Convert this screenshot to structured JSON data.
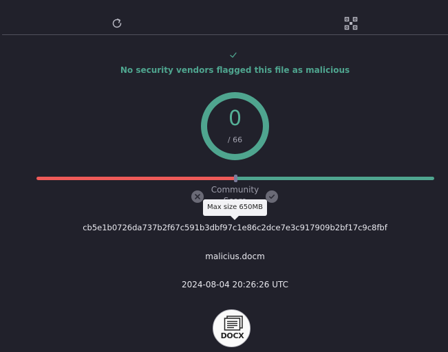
{
  "toolbar": {
    "reload_icon": "reload-icon",
    "qr_icon": "qr-code-icon"
  },
  "verdict": {
    "text": "No security vendors flagged this file as malicious",
    "color": "#4fa58f"
  },
  "detection": {
    "score": "0",
    "total": "/ 66",
    "ratio": 0
  },
  "community": {
    "label": "Community Score",
    "tooltip": "Max size 650MB",
    "score_fraction": 0.5,
    "negative_color": "#ef5a58",
    "positive_color": "#4fa58f"
  },
  "file": {
    "hash": "cb5e1b0726da737b2f67c591b3dbf97c1e86c2dce7e3c917909b2bf17c9c8fbf",
    "name": "malicius.docm",
    "date": "2024-08-04 20:26:26 UTC",
    "type_label": "DOCX"
  }
}
